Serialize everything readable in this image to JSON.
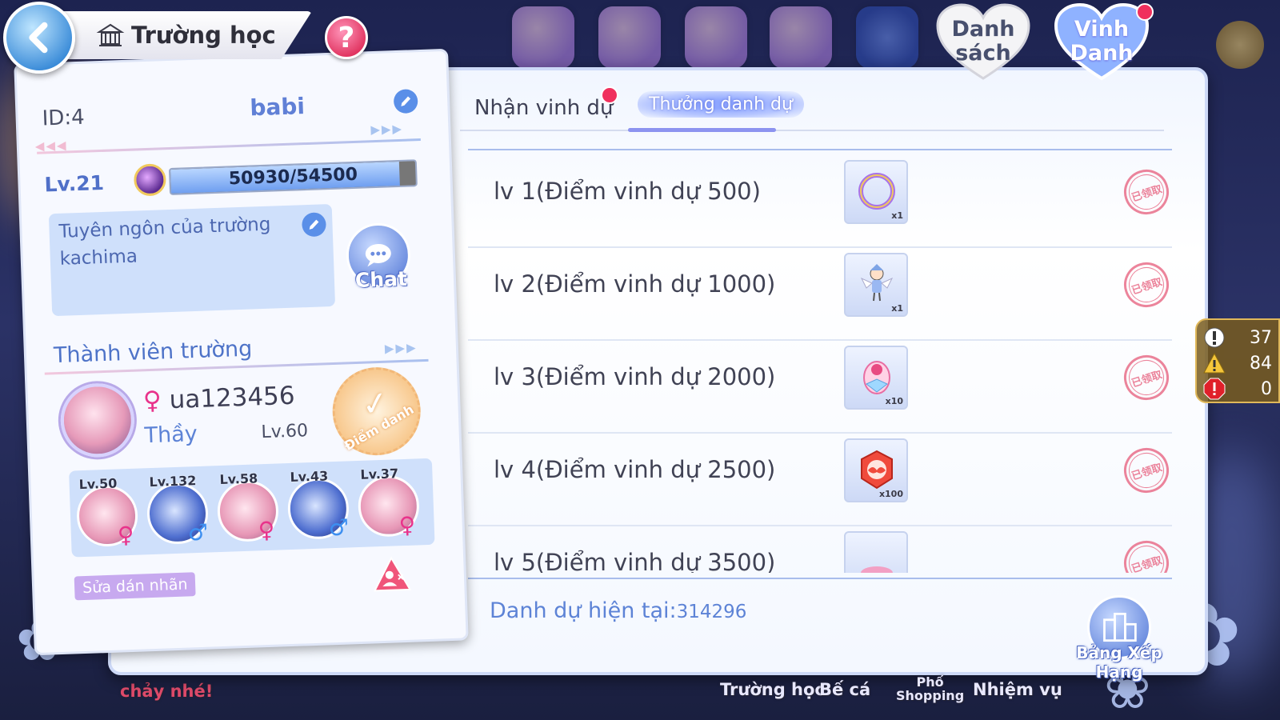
{
  "header": {
    "title": "Trường học",
    "help_label": "?",
    "danh_sach": "Danh\nsách",
    "vinh_danh": "Vinh\nDanh"
  },
  "profile": {
    "id": "ID:4",
    "name": "babi",
    "level": "Lv.21",
    "xp_text": "50930/54500",
    "xp_fraction": 0.934,
    "motto_title": "Tuyên ngôn của trường",
    "motto_text": "kachima",
    "chat_label": "Chat",
    "members_title": "Thành viên trường",
    "main_member": {
      "gender_symbol": "♀",
      "name": "ua123456",
      "role": "Thầy",
      "level": "Lv.60"
    },
    "checkin_label": "Điểm danh",
    "members": [
      {
        "level": "Lv.50",
        "gender": "♀"
      },
      {
        "level": "Lv.132",
        "gender": "♂"
      },
      {
        "level": "Lv.58",
        "gender": "♀"
      },
      {
        "level": "Lv.43",
        "gender": "♂"
      },
      {
        "level": "Lv.37",
        "gender": "♀"
      }
    ],
    "edit_label_button": "Sửa dán nhãn"
  },
  "tabs": {
    "honor": "Nhận vinh dự",
    "reward": "Thưởng danh dự"
  },
  "rewards": [
    {
      "label": "lv 1(Điểm vinh dự 500)",
      "qty": "x1",
      "icon": "ring-frame-icon",
      "stamp": "已领取"
    },
    {
      "label": "lv 2(Điểm vinh dự 1000)",
      "qty": "x1",
      "icon": "fairy-figure-icon",
      "stamp": "已领取"
    },
    {
      "label": "lv 3(Điểm vinh dự 2000)",
      "qty": "x10",
      "icon": "crystal-egg-icon",
      "stamp": "已领取"
    },
    {
      "label": "lv 4(Điểm vinh dự 2500)",
      "qty": "x100",
      "icon": "wing-badge-icon",
      "stamp": "已领取"
    },
    {
      "label": "lv 5(Điểm vinh dự 3500)",
      "qty": "",
      "icon": "flower-bed-icon",
      "stamp": "已领取"
    }
  ],
  "footer": {
    "current_honor_label": "Danh dự hiện tại:",
    "current_honor_value": "314296",
    "ranking_label": "Bảng Xếp Hạng"
  },
  "status": {
    "info_count": "37",
    "warning_count": "84",
    "error_count": "0"
  },
  "bottom_nav": [
    "Trường học",
    "Bế cá",
    "Phố\nShopping",
    "Nhiệm vụ"
  ],
  "background_text": "chảy nhé!",
  "colors": {
    "accent_blue": "#5d83d6",
    "pink_dot": "#f0305d",
    "panel_border": "#cdd9f7"
  }
}
